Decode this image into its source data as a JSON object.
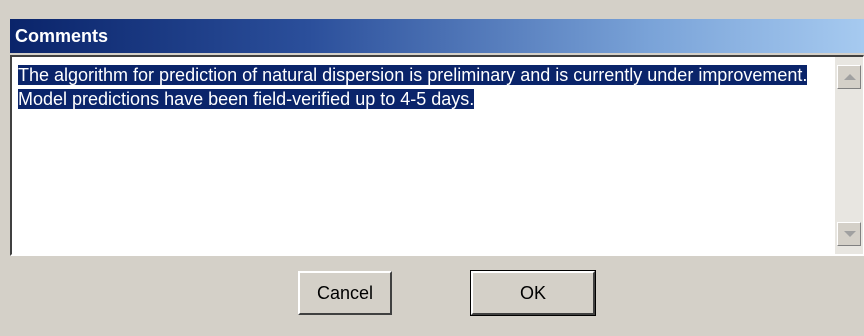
{
  "dialog": {
    "title": "Comments",
    "comment_text": "The algorithm for prediction of natural dispersion is preliminary and is currently under improvement. Model predictions have been field-verified up to 4-5 days.",
    "cancel_label": "Cancel",
    "ok_label": "OK"
  },
  "colors": {
    "titlebar_start": "#0a246a",
    "titlebar_end": "#a6caf0",
    "selection": "#0a246a",
    "face": "#d4d0c8"
  }
}
